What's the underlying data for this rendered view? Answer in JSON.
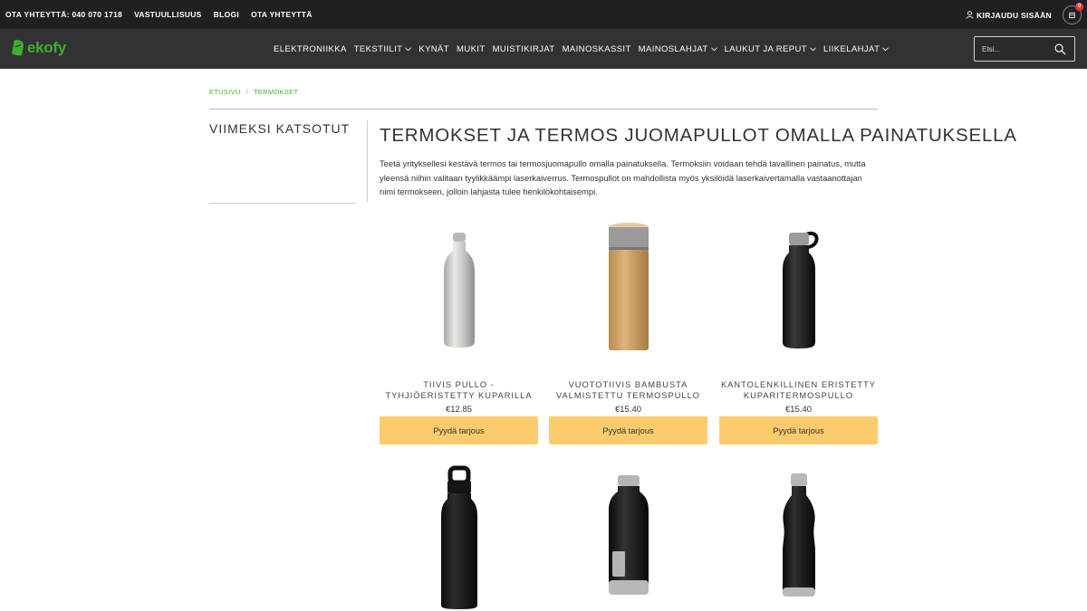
{
  "topbar": {
    "links": [
      "OTA YHTEYTTÄ: 040 070 1718",
      "VASTUULLISUUS",
      "BLOGI",
      "OTA YHTEYTTÄ"
    ],
    "login": "KIRJAUDU SISÄÄN",
    "cart_count": "0"
  },
  "brand": {
    "name": "ekofy",
    "color": "#3fae2a"
  },
  "nav": {
    "items": [
      {
        "label": "ELEKTRONIIKKA",
        "dropdown": false
      },
      {
        "label": "TEKSTIILIT",
        "dropdown": true
      },
      {
        "label": "KYNÄT",
        "dropdown": false
      },
      {
        "label": "MUKIT",
        "dropdown": false
      },
      {
        "label": "MUISTIKIRJAT",
        "dropdown": false
      },
      {
        "label": "MAINOSKASSIT",
        "dropdown": false
      },
      {
        "label": "MAINOSLAHJAT",
        "dropdown": true
      },
      {
        "label": "LAUKUT JA REPUT",
        "dropdown": true
      },
      {
        "label": "LIIKELAHJAT",
        "dropdown": true
      }
    ],
    "search_placeholder": "Etsi..."
  },
  "breadcrumb": {
    "home": "ETUSIVU",
    "separator": "/",
    "current": "TERMOKSET"
  },
  "sidebar": {
    "title": "VIIMEKSI KATSOTUT"
  },
  "main": {
    "title": "TERMOKSET JA TERMOS JUOMAPULLOT OMALLA PAINATUKSELLA",
    "intro": "Teetä yrityksellesi kestävä termos tai termosjuomapullo omalla painatuksella. Termoksiin voidaan tehdä tavallinen painatus, mutta yleensä niihin valitaan tyylikkäämpi laserkaiverrus. Termospullot on mahdollista myös yksilöidä laserkaivertamalla vastaanottajan nimi termokseen, jolloin lahjasta tulee henkilökohtaisempi."
  },
  "products": [
    {
      "name": "TIIVIS PULLO - TYHJIÖERISTETTY KUPARILLA",
      "price": "€12.85",
      "button": "Pyydä tarjous",
      "image": "silver-bottle"
    },
    {
      "name": "VUOTOTIIVIS BAMBUSTA VALMISTETTU TERMOSPULLO",
      "price": "€15.40",
      "button": "Pyydä tarjous",
      "image": "bamboo-flask"
    },
    {
      "name": "KANTOLENKILLINEN ERISTETTY KUPARITERMOSPULLO",
      "price": "€15.40",
      "button": "Pyydä tarjous",
      "image": "black-loop-bottle"
    },
    {
      "image": "black-handle-bottle"
    },
    {
      "image": "black-window-bottle"
    },
    {
      "image": "black-cola-bottle"
    }
  ],
  "colors": {
    "button": "#fccc6c",
    "topbar": "#202024",
    "navbar": "#323236",
    "link": "#3fae2a"
  }
}
